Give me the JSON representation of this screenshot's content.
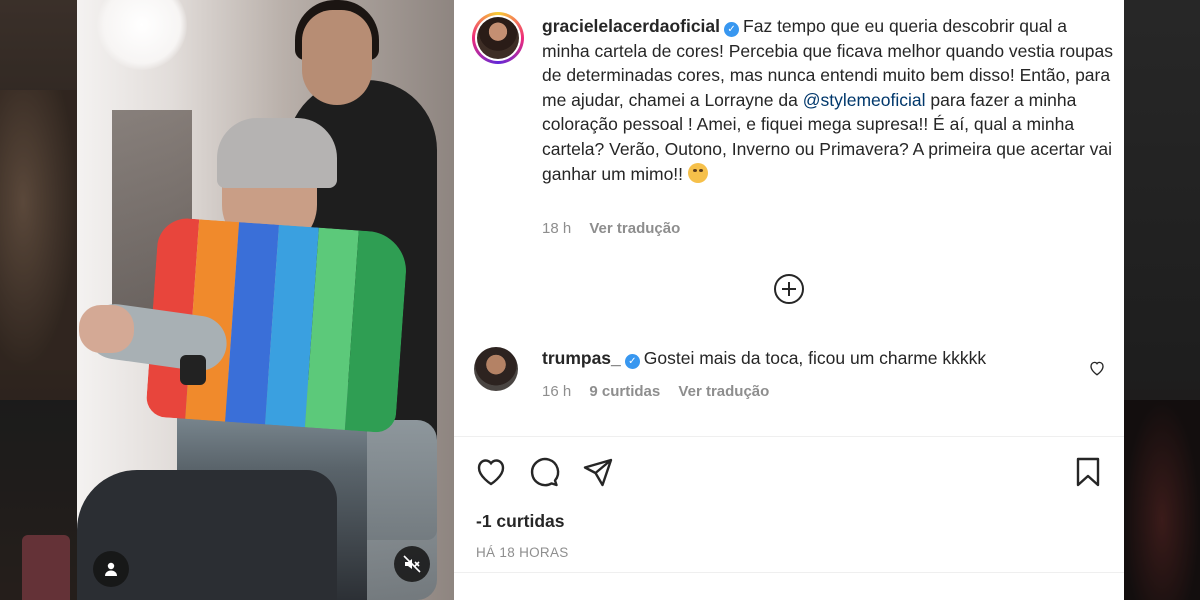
{
  "post": {
    "username": "gracielelacerdaoficial",
    "caption_before_mention": "Faz tempo que eu queria descobrir qual a minha cartela de cores! Percebia que ficava melhor quando vestia roupas de determinadas cores, mas nunca entendi muito bem disso! Então, para me ajudar, chamei a Lorrayne da ",
    "mention": "@stylemeoficial",
    "caption_after_mention": " para fazer a minha coloração pessoal ! Amei, e fiquei mega supresa!! É aí, qual a minha cartela? Verão, Outono, Inverno ou Primavera? A primeira que acertar vai ganhar um mimo!!",
    "time": "18 h",
    "translate": "Ver tradução"
  },
  "comment": {
    "username": "trumpas_",
    "text": "Gostei mais da toca, ficou um charme kkkkk",
    "time": "16 h",
    "likes": "9 curtidas",
    "translate": "Ver tradução"
  },
  "footer": {
    "likes": "-1 curtidas",
    "posted": "HÁ 18 HORAS"
  },
  "icons": {
    "load_more": "plus-circle-icon",
    "like": "heart-icon",
    "comment": "comment-icon",
    "share": "send-icon",
    "save": "bookmark-icon",
    "user_tag": "user-icon",
    "mute": "muted-speaker-icon"
  },
  "colors": {
    "verified": "#3897f0",
    "mention": "#00376b",
    "meta": "#8e8e8e"
  }
}
